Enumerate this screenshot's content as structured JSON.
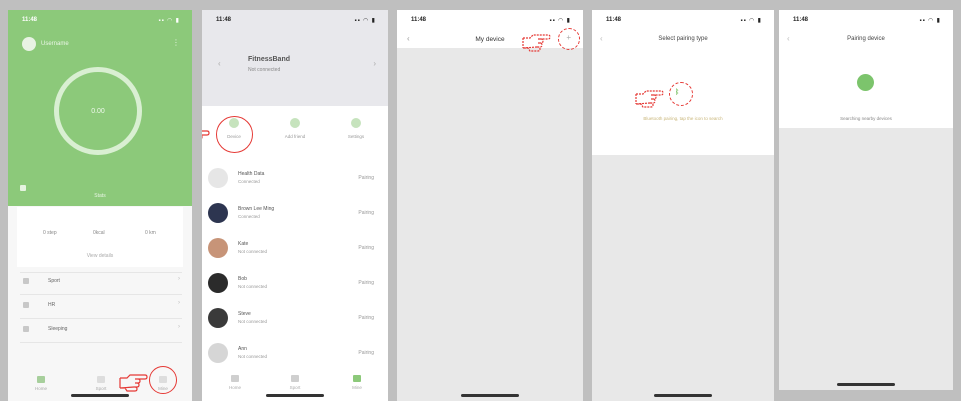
{
  "screen1": {
    "status_time": "11:48",
    "status_icons": "▪▪ ◠ ▮",
    "more_icon": "⋮",
    "username": "Username",
    "ring_value": "0.00",
    "green_label": "Stats",
    "stats": [
      "0 step",
      "0kcal",
      "0 km"
    ],
    "card_link": "View details",
    "menu": [
      "Sport",
      "HR",
      "Sleeping"
    ],
    "tabs": [
      "Home",
      "Sport",
      "Mine"
    ],
    "colors": {
      "accent": "#8cc97a",
      "annotation": "#e53935"
    }
  },
  "screen2": {
    "status_time": "11:48",
    "status_icons": "▪▪ ◠ ▮",
    "device_title": "FitnessBand",
    "device_sub": "Not connected",
    "quick_actions": [
      "Device",
      "Add friend",
      "Settings"
    ],
    "rows": [
      {
        "name": "Health Data",
        "sub": "Connected",
        "action": "Pairing"
      },
      {
        "name": "Brown Lee Ming",
        "sub": "Connected",
        "action": "Pairing"
      },
      {
        "name": "Kate",
        "sub": "Not connected",
        "action": "Pairing"
      },
      {
        "name": "Bob",
        "sub": "Not connected",
        "action": "Pairing"
      },
      {
        "name": "Steve",
        "sub": "Not connected",
        "action": "Pairing"
      },
      {
        "name": "Ann",
        "sub": "Not connected",
        "action": "Pairing"
      }
    ],
    "tabs": [
      "Home",
      "Sport",
      "Mine"
    ]
  },
  "screen3": {
    "status_time": "11:48",
    "status_icons": "▪▪ ◠ ▮",
    "title": "My device",
    "back": "‹",
    "add": "+"
  },
  "screen4": {
    "status_time": "11:48",
    "status_icons": "▪▪ ◠ ▮",
    "title": "Select pairing type",
    "back": "‹",
    "bt_symbol": "ᛒ",
    "hint": "Bluetooth pairing, tap the icon to search"
  },
  "screen5": {
    "status_time": "11:48",
    "status_icons": "▪▪ ◠ ▮",
    "title": "Pairing device",
    "back": "‹",
    "hint": "Searching nearby devices"
  }
}
